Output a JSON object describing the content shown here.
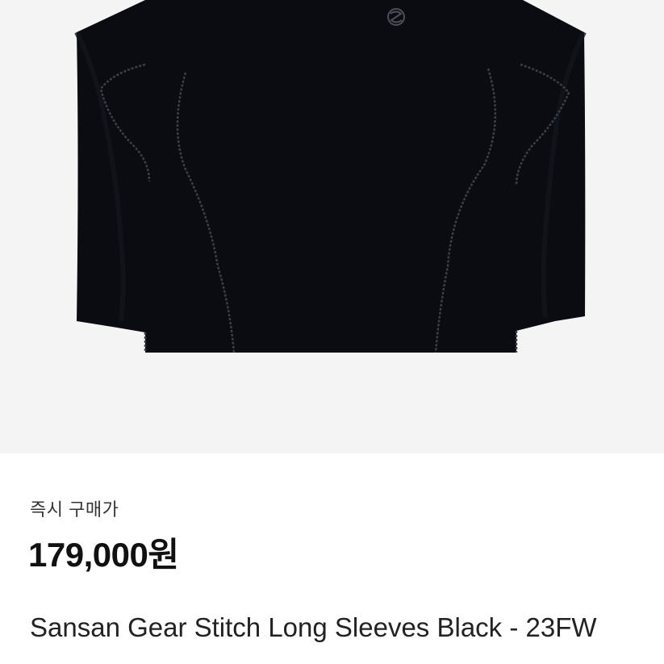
{
  "product": {
    "image_icon": "long-sleeve-shirt-photo",
    "logo_icon": "brand-logo-icon"
  },
  "purchase": {
    "label": "즉시 구매가",
    "price": "179,000원"
  },
  "title": "Sansan Gear Stitch Long Sleeves Black - 23FW",
  "colors": {
    "background": "#f4f4f4",
    "shirt": "#0a0c12",
    "stitch": "#3a3f48",
    "text_dark": "#111111"
  }
}
